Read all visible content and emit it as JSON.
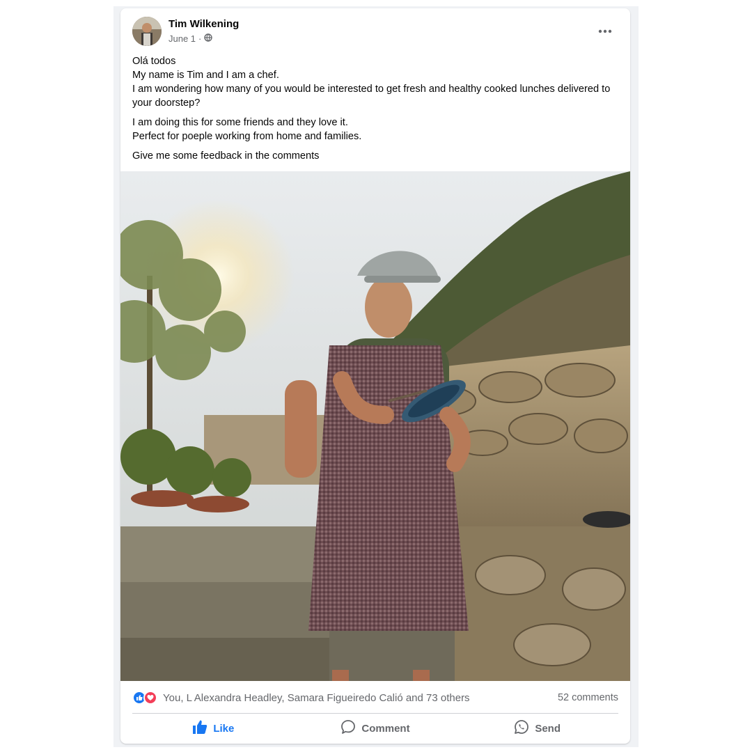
{
  "post": {
    "author": "Tim Wilkening",
    "date": "June 1",
    "separator": "·",
    "audience_icon": "globe-icon",
    "menu_icon": "more-horizontal-icon",
    "body": {
      "para1": [
        "Olá todos",
        "My name is Tim and I am a chef.",
        "I am wondering how many of you would be interested  to get fresh and healthy cooked lunches delivered to your doorstep?"
      ],
      "para2": [
        "I am doing this for some friends and they love it.",
        "Perfect for poeple working from home and families."
      ],
      "para3": [
        "Give me some feedback in the comments"
      ]
    }
  },
  "reactions": {
    "icons": [
      "like-reaction-icon",
      "love-reaction-icon"
    ],
    "summary": "You, L Alexandra Headley, Samara Figueiredo Calió and 73 others",
    "comments": "52 comments"
  },
  "actions": {
    "like": "Like",
    "comment": "Comment",
    "send": "Send"
  },
  "colors": {
    "accent": "#1877f2",
    "love": "#f33e58",
    "secondary_text": "#65676b"
  }
}
